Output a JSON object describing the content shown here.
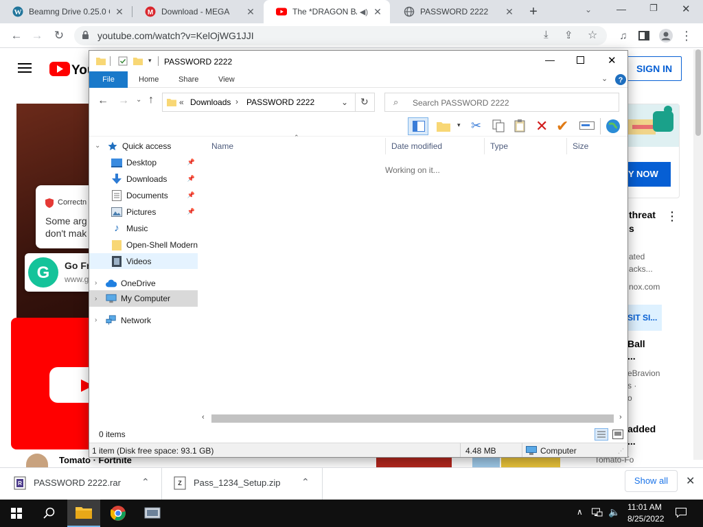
{
  "browser": {
    "tabs": [
      {
        "label": "Beamng Drive 0.25.0 C",
        "icon": "wordpress-icon",
        "active": false
      },
      {
        "label": "Download - MEGA",
        "icon": "mega-icon",
        "active": false
      },
      {
        "label": "The *DRAGON BA",
        "icon": "youtube-icon",
        "active": true
      },
      {
        "label": "PASSWORD 2222",
        "icon": "globe-icon",
        "active": false
      }
    ],
    "url": "youtube.com/watch?v=KelOjWG1JJI"
  },
  "youtube": {
    "sign_in": "SIGN IN",
    "ad_label": "Correctn",
    "ad_text_1": "Some arg",
    "ad_text_2": "don't mak",
    "grammarly_title": "Go Fre",
    "grammarly_url": "www.g",
    "buy_now": "Y NOW",
    "threat_1": "threat",
    "threat_2": "s",
    "side_1": "ated",
    "side_2": "acks...",
    "side_3": "nox.com",
    "visit": "SIT SI...",
    "ball_title": "Ball",
    "ball_dots": "...",
    "ball_channel": "eBravion",
    "ball_meta1": "s ·",
    "ball_meta2": "o",
    "added": "added",
    "added_dots": "...",
    "bottom_text": "Tomato · Fortnite",
    "bottom_right": "Tomato-Fo"
  },
  "explorer": {
    "title": "PASSWORD 2222",
    "ribbon_tabs": [
      "File",
      "Home",
      "Share",
      "View"
    ],
    "breadcrumb": {
      "prefix": "«",
      "parent": "Downloads",
      "sep": "›",
      "current": "PASSWORD 2222"
    },
    "search_placeholder": "Search PASSWORD 2222",
    "columns": [
      "Name",
      "Date modified",
      "Type",
      "Size"
    ],
    "working": "Working on it...",
    "nav": {
      "quick_access": "Quick access",
      "items": [
        "Desktop",
        "Downloads",
        "Documents",
        "Pictures",
        "Music",
        "Open-Shell Modern",
        "Videos"
      ],
      "onedrive": "OneDrive",
      "my_computer": "My Computer",
      "network": "Network"
    },
    "status_items": "0 items",
    "details_left": "1 item (Disk free space: 93.1 GB)",
    "details_size": "4.48 MB",
    "details_location": "Computer"
  },
  "downloads": {
    "items": [
      "PASSWORD 2222.rar",
      "Pass_1234_Setup.zip"
    ],
    "show_all": "Show all"
  },
  "taskbar": {
    "time": "11:01 AM",
    "date": "8/25/2022"
  }
}
